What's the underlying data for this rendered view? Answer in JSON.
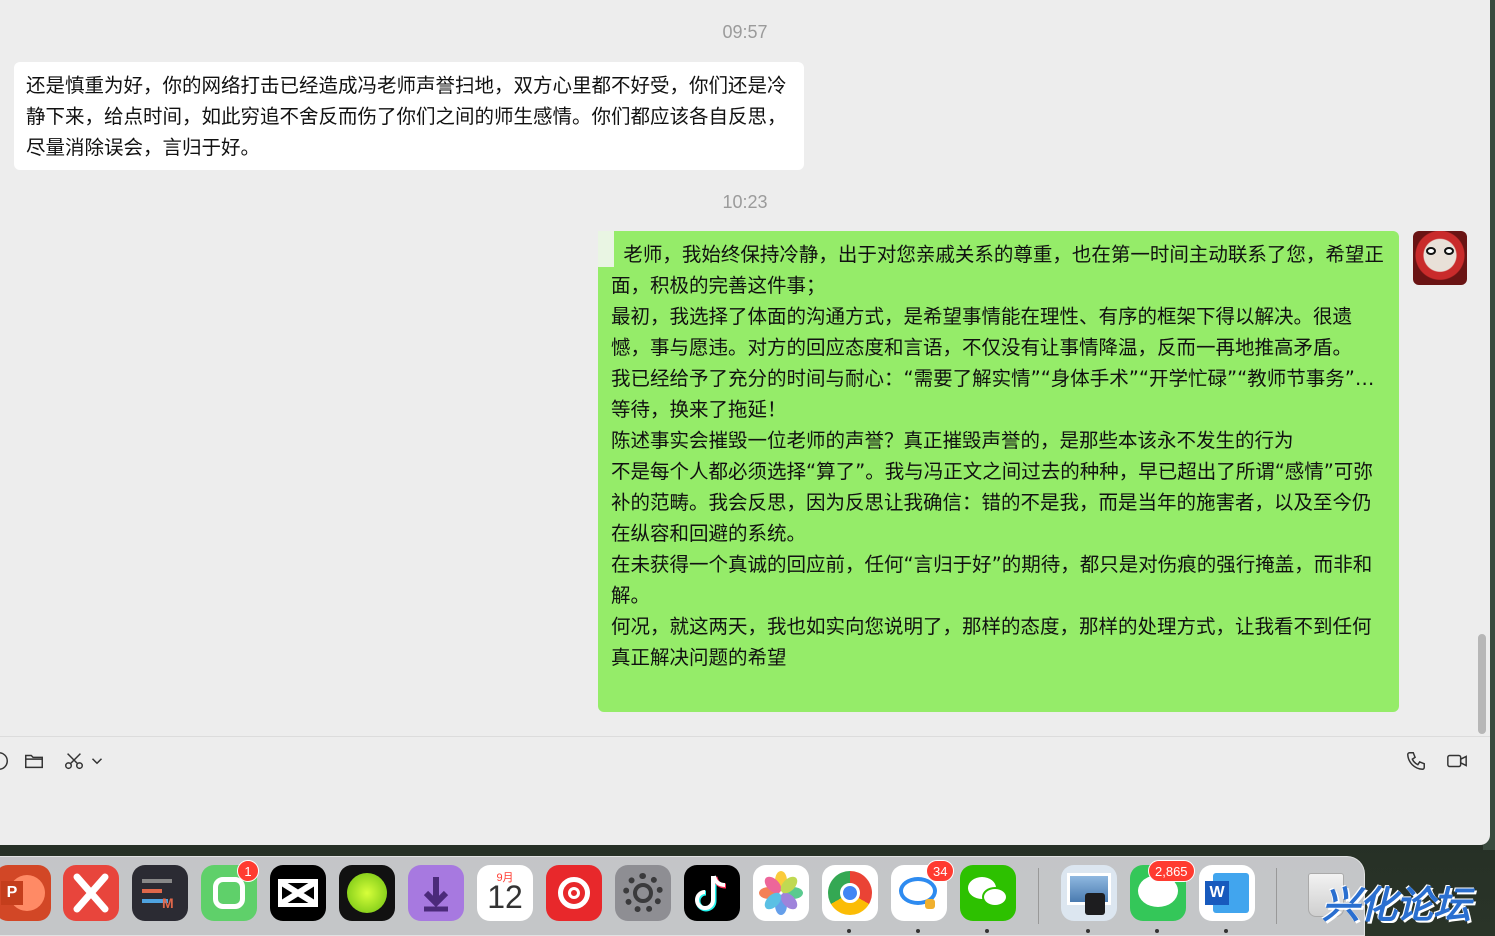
{
  "chat": {
    "messages": [
      {
        "timestamp": "09:57",
        "direction": "incoming",
        "text": "还是慎重为好，你的网络打击已经造成冯老师声誉扫地，双方心里都不好受，你们还是冷静下来，给点时间，如此穷追不舍反而伤了你们之间的师生感情。你们都应该各自反思，尽量消除误会，言归于好。"
      },
      {
        "timestamp": "10:23",
        "direction": "outgoing",
        "lines": [
          "  老师，我始终保持冷静，出于对您亲戚关系的尊重，也在第一时间主动联系了您，希望正面，积极的完善这件事；",
          "最初，我选择了体面的沟通方式，是希望事情能在理性、有序的框架下得以解决。很遗憾，事与愿违。对方的回应态度和言语，不仅没有让事情降温，反而一再地推高矛盾。",
          "我已经给予了充分的时间与耐心：“需要了解实情”“身体手术”“开学忙碌”“教师节事务”…等待，换来了拖延！",
          "陈述事实会摧毁一位老师的声誉？真正摧毁声誉的，是那些本该永不发生的行为",
          "不是每个人都必须选择“算了”。我与冯正文之间过去的种种，早已超出了所谓“感情”可弥补的范畴。我会反思，因为反思让我确信：错的不是我，而是当年的施害者，以及至今仍在纵容和回避的系统。",
          "在未获得一个真诚的回应前，任何“言归于好”的期待，都只是对伤痕的强行掩盖，而非和解。",
          "何况，就这两天，我也如实向您说明了，那样的态度，那样的处理方式，让我看不到任何真正解决问题的希望"
        ]
      }
    ]
  },
  "toolbar": {
    "left_icons": [
      "emoji-icon",
      "folder-icon",
      "scissors-icon",
      "chevron-down-icon"
    ],
    "right_icons": [
      "phone-icon",
      "video-icon"
    ]
  },
  "dock": {
    "apps": [
      {
        "name": "PowerPoint",
        "icon": "powerpoint-icon",
        "color": "#d24726"
      },
      {
        "name": "XMind",
        "icon": "xmind-icon",
        "color": "#e8453c"
      },
      {
        "name": "Code Editor",
        "icon": "editor-icon",
        "color": "#2b2b33"
      },
      {
        "name": "Mi Home",
        "icon": "mihome-icon",
        "color": "#5fd06a",
        "badge": "1"
      },
      {
        "name": "CapCut",
        "icon": "capcut-icon",
        "color": "#000000"
      },
      {
        "name": "Green Dot App",
        "icon": "greendot-icon",
        "color": "#111111"
      },
      {
        "name": "Downloader",
        "icon": "download-icon",
        "color": "#a779e0"
      },
      {
        "name": "Calendar",
        "icon": "calendar-icon",
        "color": "#ffffff",
        "month": "9月",
        "day": "12"
      },
      {
        "name": "NetEase Music",
        "icon": "music-icon",
        "color": "#e8282b"
      },
      {
        "name": "System Settings",
        "icon": "settings-icon",
        "color": "#8e8e93"
      },
      {
        "name": "TikTok",
        "icon": "tiktok-icon",
        "color": "#000000"
      },
      {
        "name": "Photos",
        "icon": "photos-icon",
        "color": "#ffffff"
      },
      {
        "name": "Chrome",
        "icon": "chrome-icon",
        "color": "#ffffff"
      },
      {
        "name": "Chat",
        "icon": "chat-icon",
        "color": "#ffffff",
        "badge": "34"
      },
      {
        "name": "WeChat",
        "icon": "wechat-icon",
        "color": "#2dc100"
      },
      {
        "name": "Preview",
        "icon": "preview-icon",
        "color": "#dce6f0"
      },
      {
        "name": "Messages",
        "icon": "messages-icon",
        "color": "#34c759",
        "badge": "2,865"
      },
      {
        "name": "Word",
        "icon": "word-icon",
        "color": "#2b5797"
      },
      {
        "name": "Trash",
        "icon": "trash-icon",
        "color": "#e6e6e6"
      }
    ]
  },
  "watermark": {
    "text": "兴化论坛"
  }
}
